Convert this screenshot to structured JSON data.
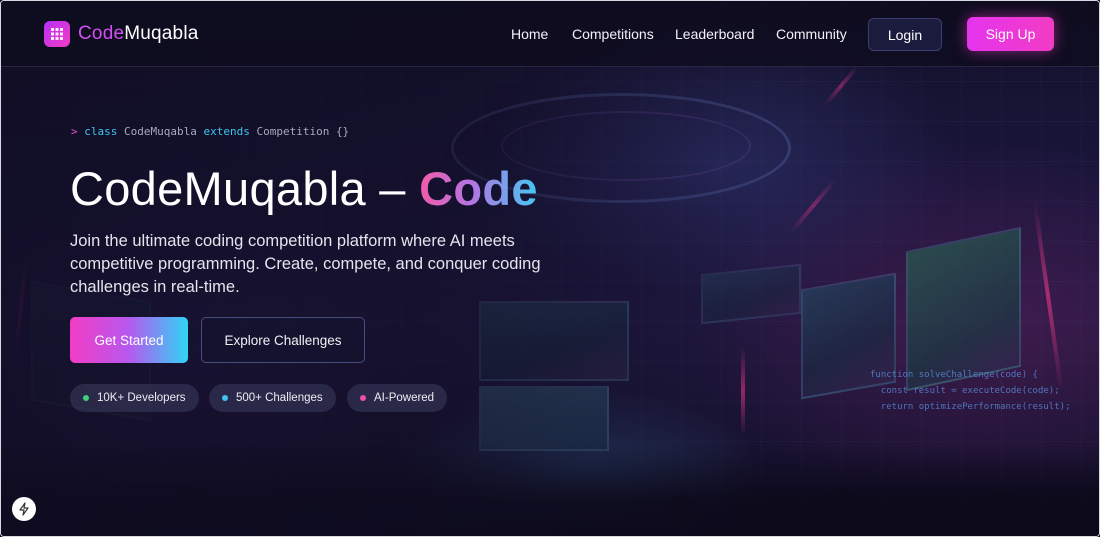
{
  "brand": {
    "name_part1": "Code",
    "name_part2": "Muqabla"
  },
  "nav": {
    "links": [
      "Home",
      "Competitions",
      "Leaderboard",
      "Community"
    ],
    "login_label": "Login",
    "signup_label": "Sign Up"
  },
  "hero": {
    "code_prefix": ">",
    "code_kw1": "class",
    "code_class": "CodeMuqabla",
    "code_kw2": "extends",
    "code_parent": "Competition {}",
    "title_main": "CodeMuqabla – ",
    "title_accent": "Code",
    "description": "Join the ultimate coding competition platform where AI meets competitive programming. Create, compete, and conquer coding challenges in real-time.",
    "primary_button": "Get Started",
    "secondary_button": "Explore Challenges",
    "stats": [
      {
        "label": "10K+ Developers",
        "dot_color": "#3fd07a"
      },
      {
        "label": "500+ Challenges",
        "dot_color": "#3fc4f0"
      },
      {
        "label": "AI-Powered",
        "dot_color": "#f04fa8"
      }
    ]
  },
  "code_snippet": {
    "line1": "function solveChallenge(code) {",
    "line2": "  const result = executeCode(code);",
    "line3": "  return optimizePerformance(result);"
  },
  "colors": {
    "accent_pink": "#f23cc4",
    "accent_purple": "#b659ef",
    "accent_cyan": "#2fd4f6",
    "background": "#14122c"
  },
  "icons": {
    "logo": "grid-logo-icon",
    "floating": "bolt-icon"
  }
}
